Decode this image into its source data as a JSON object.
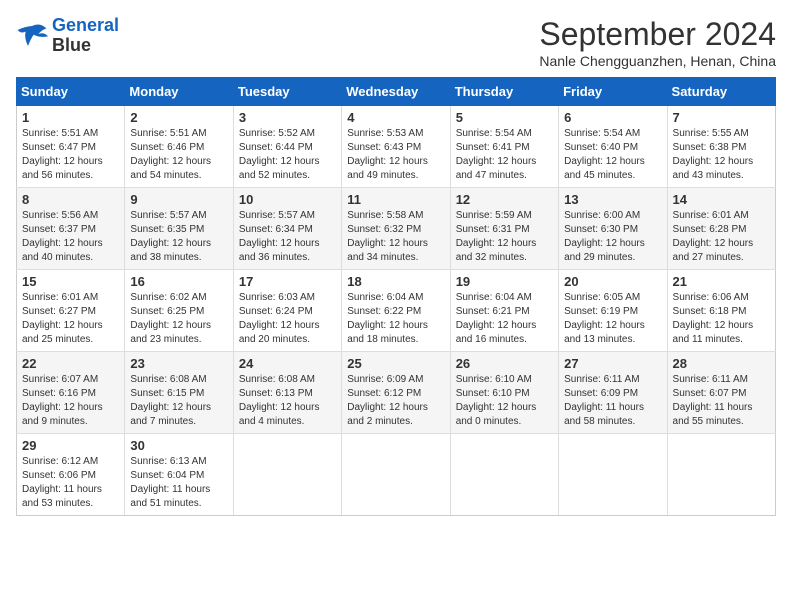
{
  "logo": {
    "line1": "General",
    "line2": "Blue"
  },
  "title": "September 2024",
  "location": "Nanle Chengguanzhen, Henan, China",
  "weekdays": [
    "Sunday",
    "Monday",
    "Tuesday",
    "Wednesday",
    "Thursday",
    "Friday",
    "Saturday"
  ],
  "weeks": [
    [
      {
        "day": "1",
        "info": "Sunrise: 5:51 AM\nSunset: 6:47 PM\nDaylight: 12 hours\nand 56 minutes."
      },
      {
        "day": "2",
        "info": "Sunrise: 5:51 AM\nSunset: 6:46 PM\nDaylight: 12 hours\nand 54 minutes."
      },
      {
        "day": "3",
        "info": "Sunrise: 5:52 AM\nSunset: 6:44 PM\nDaylight: 12 hours\nand 52 minutes."
      },
      {
        "day": "4",
        "info": "Sunrise: 5:53 AM\nSunset: 6:43 PM\nDaylight: 12 hours\nand 49 minutes."
      },
      {
        "day": "5",
        "info": "Sunrise: 5:54 AM\nSunset: 6:41 PM\nDaylight: 12 hours\nand 47 minutes."
      },
      {
        "day": "6",
        "info": "Sunrise: 5:54 AM\nSunset: 6:40 PM\nDaylight: 12 hours\nand 45 minutes."
      },
      {
        "day": "7",
        "info": "Sunrise: 5:55 AM\nSunset: 6:38 PM\nDaylight: 12 hours\nand 43 minutes."
      }
    ],
    [
      {
        "day": "8",
        "info": "Sunrise: 5:56 AM\nSunset: 6:37 PM\nDaylight: 12 hours\nand 40 minutes."
      },
      {
        "day": "9",
        "info": "Sunrise: 5:57 AM\nSunset: 6:35 PM\nDaylight: 12 hours\nand 38 minutes."
      },
      {
        "day": "10",
        "info": "Sunrise: 5:57 AM\nSunset: 6:34 PM\nDaylight: 12 hours\nand 36 minutes."
      },
      {
        "day": "11",
        "info": "Sunrise: 5:58 AM\nSunset: 6:32 PM\nDaylight: 12 hours\nand 34 minutes."
      },
      {
        "day": "12",
        "info": "Sunrise: 5:59 AM\nSunset: 6:31 PM\nDaylight: 12 hours\nand 32 minutes."
      },
      {
        "day": "13",
        "info": "Sunrise: 6:00 AM\nSunset: 6:30 PM\nDaylight: 12 hours\nand 29 minutes."
      },
      {
        "day": "14",
        "info": "Sunrise: 6:01 AM\nSunset: 6:28 PM\nDaylight: 12 hours\nand 27 minutes."
      }
    ],
    [
      {
        "day": "15",
        "info": "Sunrise: 6:01 AM\nSunset: 6:27 PM\nDaylight: 12 hours\nand 25 minutes."
      },
      {
        "day": "16",
        "info": "Sunrise: 6:02 AM\nSunset: 6:25 PM\nDaylight: 12 hours\nand 23 minutes."
      },
      {
        "day": "17",
        "info": "Sunrise: 6:03 AM\nSunset: 6:24 PM\nDaylight: 12 hours\nand 20 minutes."
      },
      {
        "day": "18",
        "info": "Sunrise: 6:04 AM\nSunset: 6:22 PM\nDaylight: 12 hours\nand 18 minutes."
      },
      {
        "day": "19",
        "info": "Sunrise: 6:04 AM\nSunset: 6:21 PM\nDaylight: 12 hours\nand 16 minutes."
      },
      {
        "day": "20",
        "info": "Sunrise: 6:05 AM\nSunset: 6:19 PM\nDaylight: 12 hours\nand 13 minutes."
      },
      {
        "day": "21",
        "info": "Sunrise: 6:06 AM\nSunset: 6:18 PM\nDaylight: 12 hours\nand 11 minutes."
      }
    ],
    [
      {
        "day": "22",
        "info": "Sunrise: 6:07 AM\nSunset: 6:16 PM\nDaylight: 12 hours\nand 9 minutes."
      },
      {
        "day": "23",
        "info": "Sunrise: 6:08 AM\nSunset: 6:15 PM\nDaylight: 12 hours\nand 7 minutes."
      },
      {
        "day": "24",
        "info": "Sunrise: 6:08 AM\nSunset: 6:13 PM\nDaylight: 12 hours\nand 4 minutes."
      },
      {
        "day": "25",
        "info": "Sunrise: 6:09 AM\nSunset: 6:12 PM\nDaylight: 12 hours\nand 2 minutes."
      },
      {
        "day": "26",
        "info": "Sunrise: 6:10 AM\nSunset: 6:10 PM\nDaylight: 12 hours\nand 0 minutes."
      },
      {
        "day": "27",
        "info": "Sunrise: 6:11 AM\nSunset: 6:09 PM\nDaylight: 11 hours\nand 58 minutes."
      },
      {
        "day": "28",
        "info": "Sunrise: 6:11 AM\nSunset: 6:07 PM\nDaylight: 11 hours\nand 55 minutes."
      }
    ],
    [
      {
        "day": "29",
        "info": "Sunrise: 6:12 AM\nSunset: 6:06 PM\nDaylight: 11 hours\nand 53 minutes."
      },
      {
        "day": "30",
        "info": "Sunrise: 6:13 AM\nSunset: 6:04 PM\nDaylight: 11 hours\nand 51 minutes."
      },
      {
        "day": "",
        "info": ""
      },
      {
        "day": "",
        "info": ""
      },
      {
        "day": "",
        "info": ""
      },
      {
        "day": "",
        "info": ""
      },
      {
        "day": "",
        "info": ""
      }
    ]
  ]
}
